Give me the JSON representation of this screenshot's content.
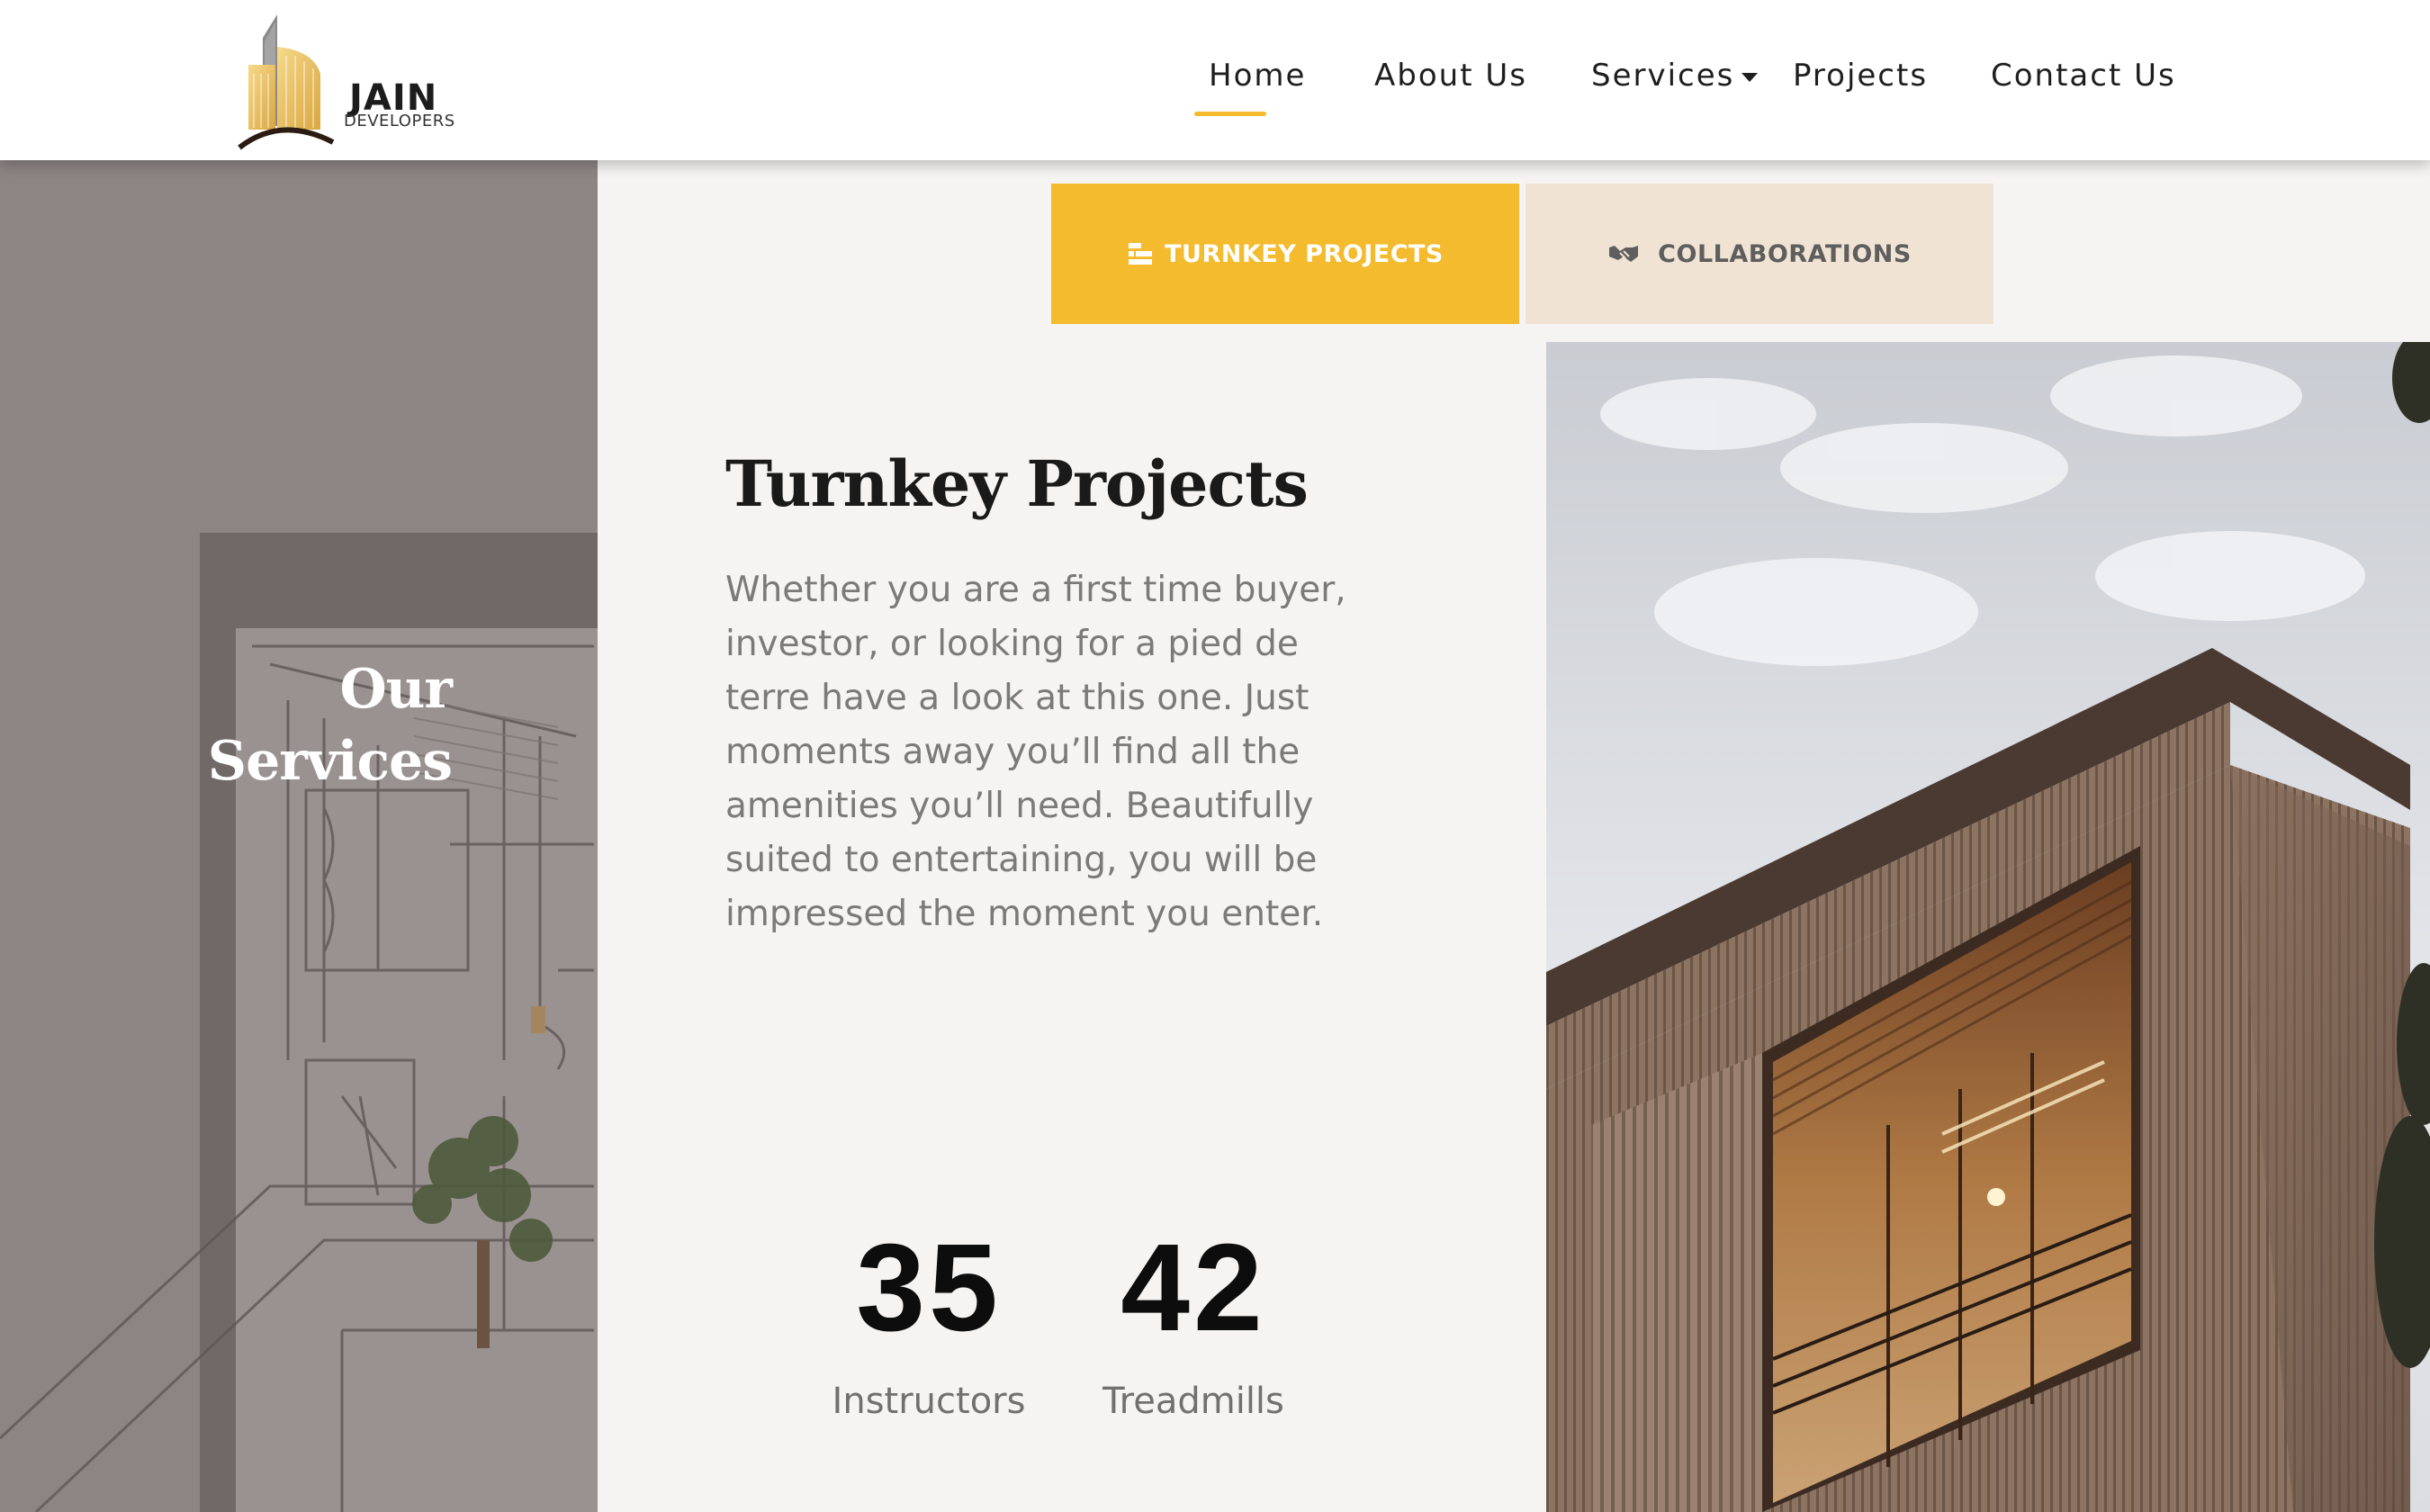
{
  "header": {
    "logo": {
      "word": "JAIN",
      "sub": "DEVELOPERS"
    },
    "nav": [
      {
        "label": "Home",
        "active": true
      },
      {
        "label": "About Us"
      },
      {
        "label": "Services",
        "has_dropdown": true
      },
      {
        "label": "Projects"
      },
      {
        "label": "Contact Us"
      }
    ]
  },
  "hero": {
    "title_line1": "Our",
    "title_line2": "Services"
  },
  "tabs": [
    {
      "label": "TURNKEY PROJECTS",
      "icon": "blocks-icon",
      "active": true
    },
    {
      "label": "COLLABORATIONS",
      "icon": "handshake-icon",
      "active": false
    }
  ],
  "content": {
    "title": "Turnkey Projects",
    "body": "Whether you are a first time buyer, investor, or looking for a pied de terre have a look at this one. Just moments away you’ll find all the amenities you’ll need. Beautifully suited to entertaining, you will be impressed the moment you enter."
  },
  "stats": [
    {
      "value": "35",
      "label": "Instructors"
    },
    {
      "value": "42",
      "label": "Treadmills"
    }
  ],
  "colors": {
    "accent": "#f3bb2d",
    "tab_inactive": "#f1e3d3",
    "left_panel": "#8d8584",
    "page_bg": "#f5f4f2"
  }
}
